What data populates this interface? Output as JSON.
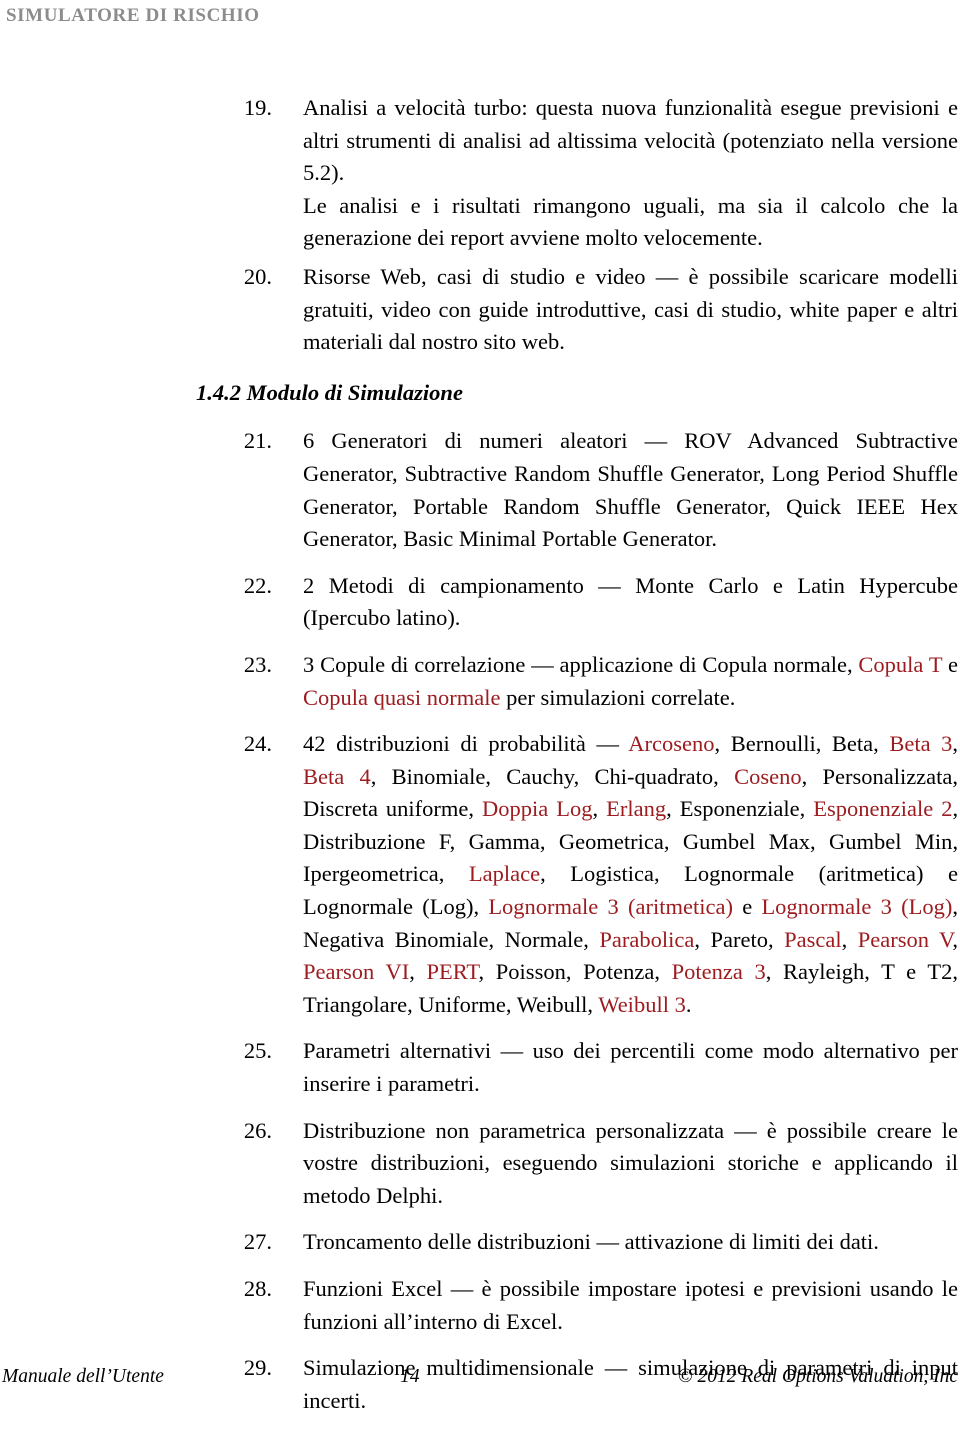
{
  "header": {
    "running_title": "SIMULATORE DI RISCHIO"
  },
  "section_heading": "1.4.2 Modulo di Simulazione",
  "items": {
    "i19": {
      "number": "19.",
      "p1": "Analisi a velocità turbo: questa nuova funzionalità esegue previsioni e altri strumenti di analisi ad altissima velocità (potenziato nella versione 5.2).",
      "p2": "Le analisi e i risultati rimangono uguali, ma sia il calcolo che la generazione dei report avviene molto velocemente."
    },
    "i20": {
      "number": "20.",
      "text": "Risorse Web, casi di studio e video — è possibile scaricare modelli gratuiti, video con guide introduttive, casi di studio, white paper e altri materiali dal nostro sito web."
    },
    "i21": {
      "number": "21.",
      "text": "6 Generatori di numeri aleatori — ROV Advanced Subtractive Generator, Subtractive Random Shuffle Generator, Long Period Shuffle Generator, Portable Random Shuffle Generator, Quick IEEE Hex Generator, Basic Minimal Portable Generator."
    },
    "i22": {
      "number": "22.",
      "text": "2 Metodi di campionamento — Monte Carlo e Latin Hypercube (Ipercubo latino)."
    },
    "i23": {
      "number": "23.",
      "seg1": "3 Copule di correlazione — applicazione di Copula normale, ",
      "seg2_red": "Copula T",
      "seg3": " e ",
      "seg4_red": "Copula quasi normale",
      "seg5": " per simulazioni correlate."
    },
    "i24": {
      "number": "24.",
      "lead": "42 distribuzioni di probabilità — ",
      "distributions": [
        {
          "name": "Arcoseno",
          "highlight": true,
          "sep": ", "
        },
        {
          "name": "Bernoulli",
          "highlight": false,
          "sep": ", "
        },
        {
          "name": "Beta",
          "highlight": false,
          "sep": ", "
        },
        {
          "name": "Beta 3",
          "highlight": true,
          "sep": ", "
        },
        {
          "name": "Beta 4",
          "highlight": true,
          "sep": ", "
        },
        {
          "name": "Binomiale",
          "highlight": false,
          "sep": ", "
        },
        {
          "name": "Cauchy",
          "highlight": false,
          "sep": ", "
        },
        {
          "name": "Chi-quadrato",
          "highlight": false,
          "sep": ", "
        },
        {
          "name": "Coseno",
          "highlight": true,
          "sep": ", "
        },
        {
          "name": "Personalizzata",
          "highlight": false,
          "sep": ", "
        },
        {
          "name": "Discreta uniforme",
          "highlight": false,
          "sep": ", "
        },
        {
          "name": "Doppia Log",
          "highlight": true,
          "sep": ", "
        },
        {
          "name": "Erlang",
          "highlight": true,
          "sep": ", "
        },
        {
          "name": "Esponenziale",
          "highlight": false,
          "sep": ", "
        },
        {
          "name": "Esponenziale 2",
          "highlight": true,
          "sep": ", "
        },
        {
          "name": "Distribuzione F",
          "highlight": false,
          "sep": ", "
        },
        {
          "name": "Gamma",
          "highlight": false,
          "sep": ", "
        },
        {
          "name": "Geometrica",
          "highlight": false,
          "sep": ", "
        },
        {
          "name": "Gumbel Max",
          "highlight": false,
          "sep": ", "
        },
        {
          "name": "Gumbel Min",
          "highlight": false,
          "sep": ", "
        },
        {
          "name": "Ipergeometrica",
          "highlight": false,
          "sep": ", "
        },
        {
          "name": "Laplace",
          "highlight": true,
          "sep": ", "
        },
        {
          "name": "Logistica",
          "highlight": false,
          "sep": ", "
        },
        {
          "name": "Lognormale (aritmetica)",
          "highlight": false,
          "sep": " e "
        },
        {
          "name": "Lognormale (Log)",
          "highlight": false,
          "sep": ", "
        },
        {
          "name": "Lognormale 3 (aritmetica)",
          "highlight": true,
          "sep": " e "
        },
        {
          "name": "Lognormale 3 (Log)",
          "highlight": true,
          "sep": ", "
        },
        {
          "name": "Negativa Binomiale",
          "highlight": false,
          "sep": ", "
        },
        {
          "name": "Normale",
          "highlight": false,
          "sep": ", "
        },
        {
          "name": "Parabolica",
          "highlight": true,
          "sep": ", "
        },
        {
          "name": "Pareto",
          "highlight": false,
          "sep": ", "
        },
        {
          "name": "Pascal",
          "highlight": true,
          "sep": ", "
        },
        {
          "name": "Pearson V",
          "highlight": true,
          "sep": ", "
        },
        {
          "name": "Pearson VI",
          "highlight": true,
          "sep": ", "
        },
        {
          "name": "PERT",
          "highlight": true,
          "sep": ", "
        },
        {
          "name": "Poisson",
          "highlight": false,
          "sep": ", "
        },
        {
          "name": "Potenza",
          "highlight": false,
          "sep": ", "
        },
        {
          "name": "Potenza 3",
          "highlight": true,
          "sep": ", "
        },
        {
          "name": "Rayleigh",
          "highlight": false,
          "sep": ", "
        },
        {
          "name": "T",
          "highlight": false,
          "sep": " e "
        },
        {
          "name": "T2",
          "highlight": false,
          "sep": ", "
        },
        {
          "name": "Triangolare",
          "highlight": false,
          "sep": ", "
        },
        {
          "name": "Uniforme",
          "highlight": false,
          "sep": ", "
        },
        {
          "name": "Weibull",
          "highlight": false,
          "sep": ", "
        },
        {
          "name": "Weibull 3",
          "highlight": true,
          "sep": "."
        }
      ]
    },
    "i25": {
      "number": "25.",
      "text": "Parametri alternativi — uso dei percentili come modo alternativo per inserire i parametri."
    },
    "i26": {
      "number": "26.",
      "text": "Distribuzione non parametrica personalizzata — è possibile creare le vostre distribuzioni, eseguendo simulazioni storiche e applicando il metodo Delphi."
    },
    "i27": {
      "number": "27.",
      "text": "Troncamento delle distribuzioni — attivazione di limiti dei dati."
    },
    "i28": {
      "number": "28.",
      "text": "Funzioni Excel — è possibile impostare ipotesi e previsioni usando le funzioni all’interno di Excel."
    },
    "i29": {
      "number": "29.",
      "text": "Simulazione multidimensionale — simulazione di parametri di input incerti."
    }
  },
  "footer": {
    "left": "Manuale dell’Utente",
    "page_number": "14",
    "right": "© 2012 Real Options Valuation, Inc"
  },
  "colors": {
    "header_gray": "#8c8c8c",
    "highlight_red": "#9c1c20",
    "body_text": "#000000",
    "page_background": "#ffffff"
  }
}
